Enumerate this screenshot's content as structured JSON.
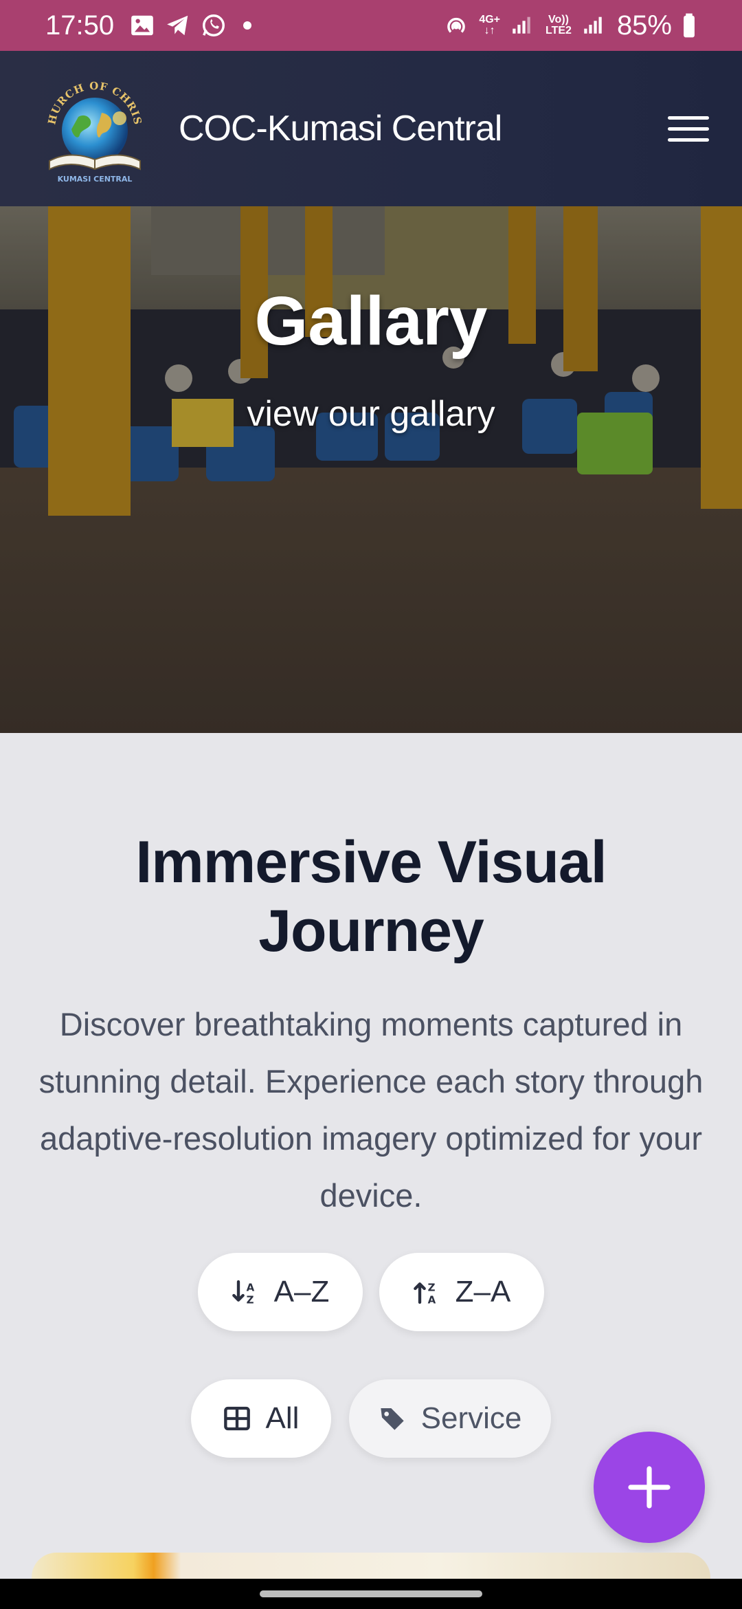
{
  "status_bar": {
    "time": "17:50",
    "network_4g": "4G+",
    "volte_top": "Vo))",
    "volte_bottom": "LTE2",
    "battery": "85%"
  },
  "header": {
    "site_name": "COC-Kumasi Central",
    "logo_text_top": "CHURCH OF CHRIST",
    "logo_text_bottom": "KUMASI CENTRAL"
  },
  "hero": {
    "title": "Gallary",
    "subtitle": "view our gallary"
  },
  "section": {
    "title": "Immersive Visual Journey",
    "description": "Discover breathtaking moments captured in stunning detail. Experience each story through adaptive-resolution imagery optimized for your device."
  },
  "sort_buttons": {
    "az": "A–Z",
    "za": "Z–A"
  },
  "filters": {
    "all": "All",
    "service": "Service"
  },
  "colors": {
    "status_bar": "#a9406f",
    "header": "#242a44",
    "fab": "#9b45e6",
    "title_text": "#141a2c"
  },
  "icons": [
    "image-icon",
    "telegram-icon",
    "whatsapp-icon",
    "hotspot-icon",
    "signal-icon",
    "battery-icon",
    "menu-icon",
    "sort-asc-icon",
    "sort-desc-icon",
    "grid-icon",
    "tag-icon",
    "plus-icon"
  ]
}
